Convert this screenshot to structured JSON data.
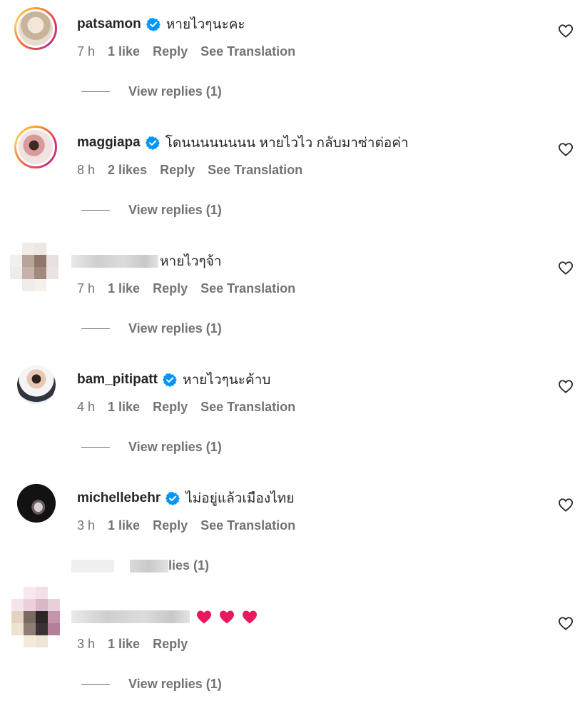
{
  "comments": [
    {
      "username": "patsamon",
      "verified": true,
      "text": "หายไวๆนะคะ",
      "time": "7 h",
      "likes": "1 like",
      "reply": "Reply",
      "translate": "See Translation",
      "view_replies": "View replies (1)"
    },
    {
      "username": "maggiapa",
      "verified": true,
      "text": "โดนนนนนนนน หายไวไว กลับมาซ่าต่อค่า",
      "time": "8 h",
      "likes": "2 likes",
      "reply": "Reply",
      "translate": "See Translation",
      "view_replies": "View replies (1)"
    },
    {
      "username": "",
      "verified": false,
      "text": "หายไวๆจ้า",
      "time": "7 h",
      "likes": "1 like",
      "reply": "Reply",
      "translate": "See Translation",
      "view_replies": "View replies (1)"
    },
    {
      "username": "bam_pitipatt",
      "verified": true,
      "text": "หายไวๆนะค้าบ",
      "time": "4 h",
      "likes": "1 like",
      "reply": "Reply",
      "translate": "See Translation",
      "view_replies": "View replies (1)"
    },
    {
      "username": "michellebehr",
      "verified": true,
      "text": "ไม่อยู่แล้วเมืองไทย",
      "time": "3 h",
      "likes": "1 like",
      "reply": "Reply",
      "translate": "See Translation",
      "view_replies": "lies (1)"
    },
    {
      "username": "",
      "verified": false,
      "text": "",
      "time": "3 h",
      "likes": "1 like",
      "reply": "Reply",
      "translate": "",
      "view_replies": "View replies (1)"
    }
  ],
  "colors": {
    "verified": "#0095f6",
    "muted": "#737373",
    "text": "#262626",
    "heart_emoji": "#e8185f"
  },
  "icons": {
    "like": "heart-outline-icon",
    "verified": "verified-badge-icon"
  }
}
